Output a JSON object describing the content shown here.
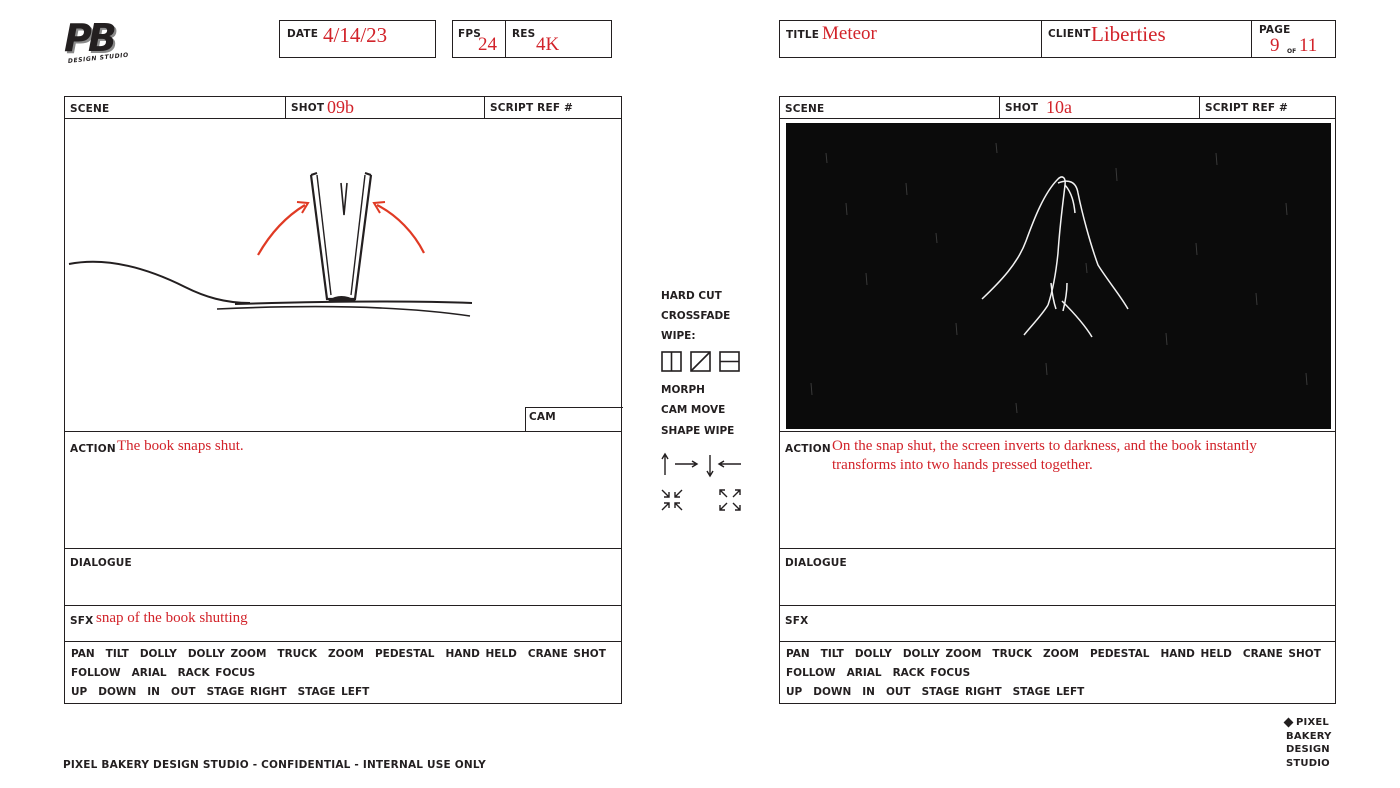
{
  "header": {
    "logo": "PB",
    "logo_subtitle": "DESIGN STUDIO",
    "date_label": "DATE",
    "date_value": "4/14/23",
    "fps_label": "FPS",
    "fps_value": "24",
    "res_label": "RES",
    "res_value": "4K",
    "title_label": "TITLE",
    "title_value": "Meteor",
    "client_label": "CLIENT",
    "client_value": "Liberties",
    "page_label": "PAGE",
    "page_current": "9",
    "page_of": "OF",
    "page_total": "11"
  },
  "panels": [
    {
      "scene_label": "SCENE",
      "shot_label": "SHOT",
      "shot_value": "09b",
      "script_ref_label": "SCRIPT REF #",
      "cam_label": "CAM",
      "action_label": "ACTION",
      "action_lines": [
        "The book snaps shut.",
        ""
      ],
      "dialogue_label": "DIALOGUE",
      "sfx_label": "SFX",
      "sfx_value": "snap of the book shutting"
    },
    {
      "scene_label": "SCENE",
      "shot_label": "SHOT",
      "shot_value": "10a",
      "script_ref_label": "SCRIPT REF #",
      "cam_label": "",
      "action_label": "ACTION",
      "action_lines": [
        "On the snap shut, the screen inverts to darkness, and the book instantly",
        "transforms into two hands pressed together."
      ],
      "dialogue_label": "DIALOGUE",
      "sfx_label": "SFX",
      "sfx_value": ""
    }
  ],
  "camera_moves": {
    "row1": [
      "PAN",
      "TILT",
      "DOLLY",
      "DOLLY ZOOM",
      "TRUCK",
      "ZOOM",
      "PEDESTAL",
      "HAND HELD",
      "CRANE SHOT"
    ],
    "row2": [
      "FOLLOW",
      "ARIAL",
      "RACK FOCUS"
    ],
    "row3": [
      "UP",
      "DOWN",
      "IN",
      "OUT",
      "STAGE RIGHT",
      "STAGE LEFT"
    ]
  },
  "transitions": {
    "hard_cut": "HARD CUT",
    "crossfade": "CROSSFADE",
    "wipe": "WIPE:",
    "morph": "MORPH",
    "cam_move": "CAM MOVE",
    "shape_wipe": "SHAPE WIPE"
  },
  "footer": {
    "confidential": "PIXEL BAKERY DESIGN STUDIO - CONFIDENTIAL - INTERNAL USE ONLY",
    "brand_lines": [
      "PIXEL",
      "BAKERY",
      "DESIGN",
      "STUDIO"
    ]
  },
  "colors": {
    "ink": "#231f20",
    "handwriting": "#d2232a",
    "frame_dark": "#0b0b0b"
  }
}
